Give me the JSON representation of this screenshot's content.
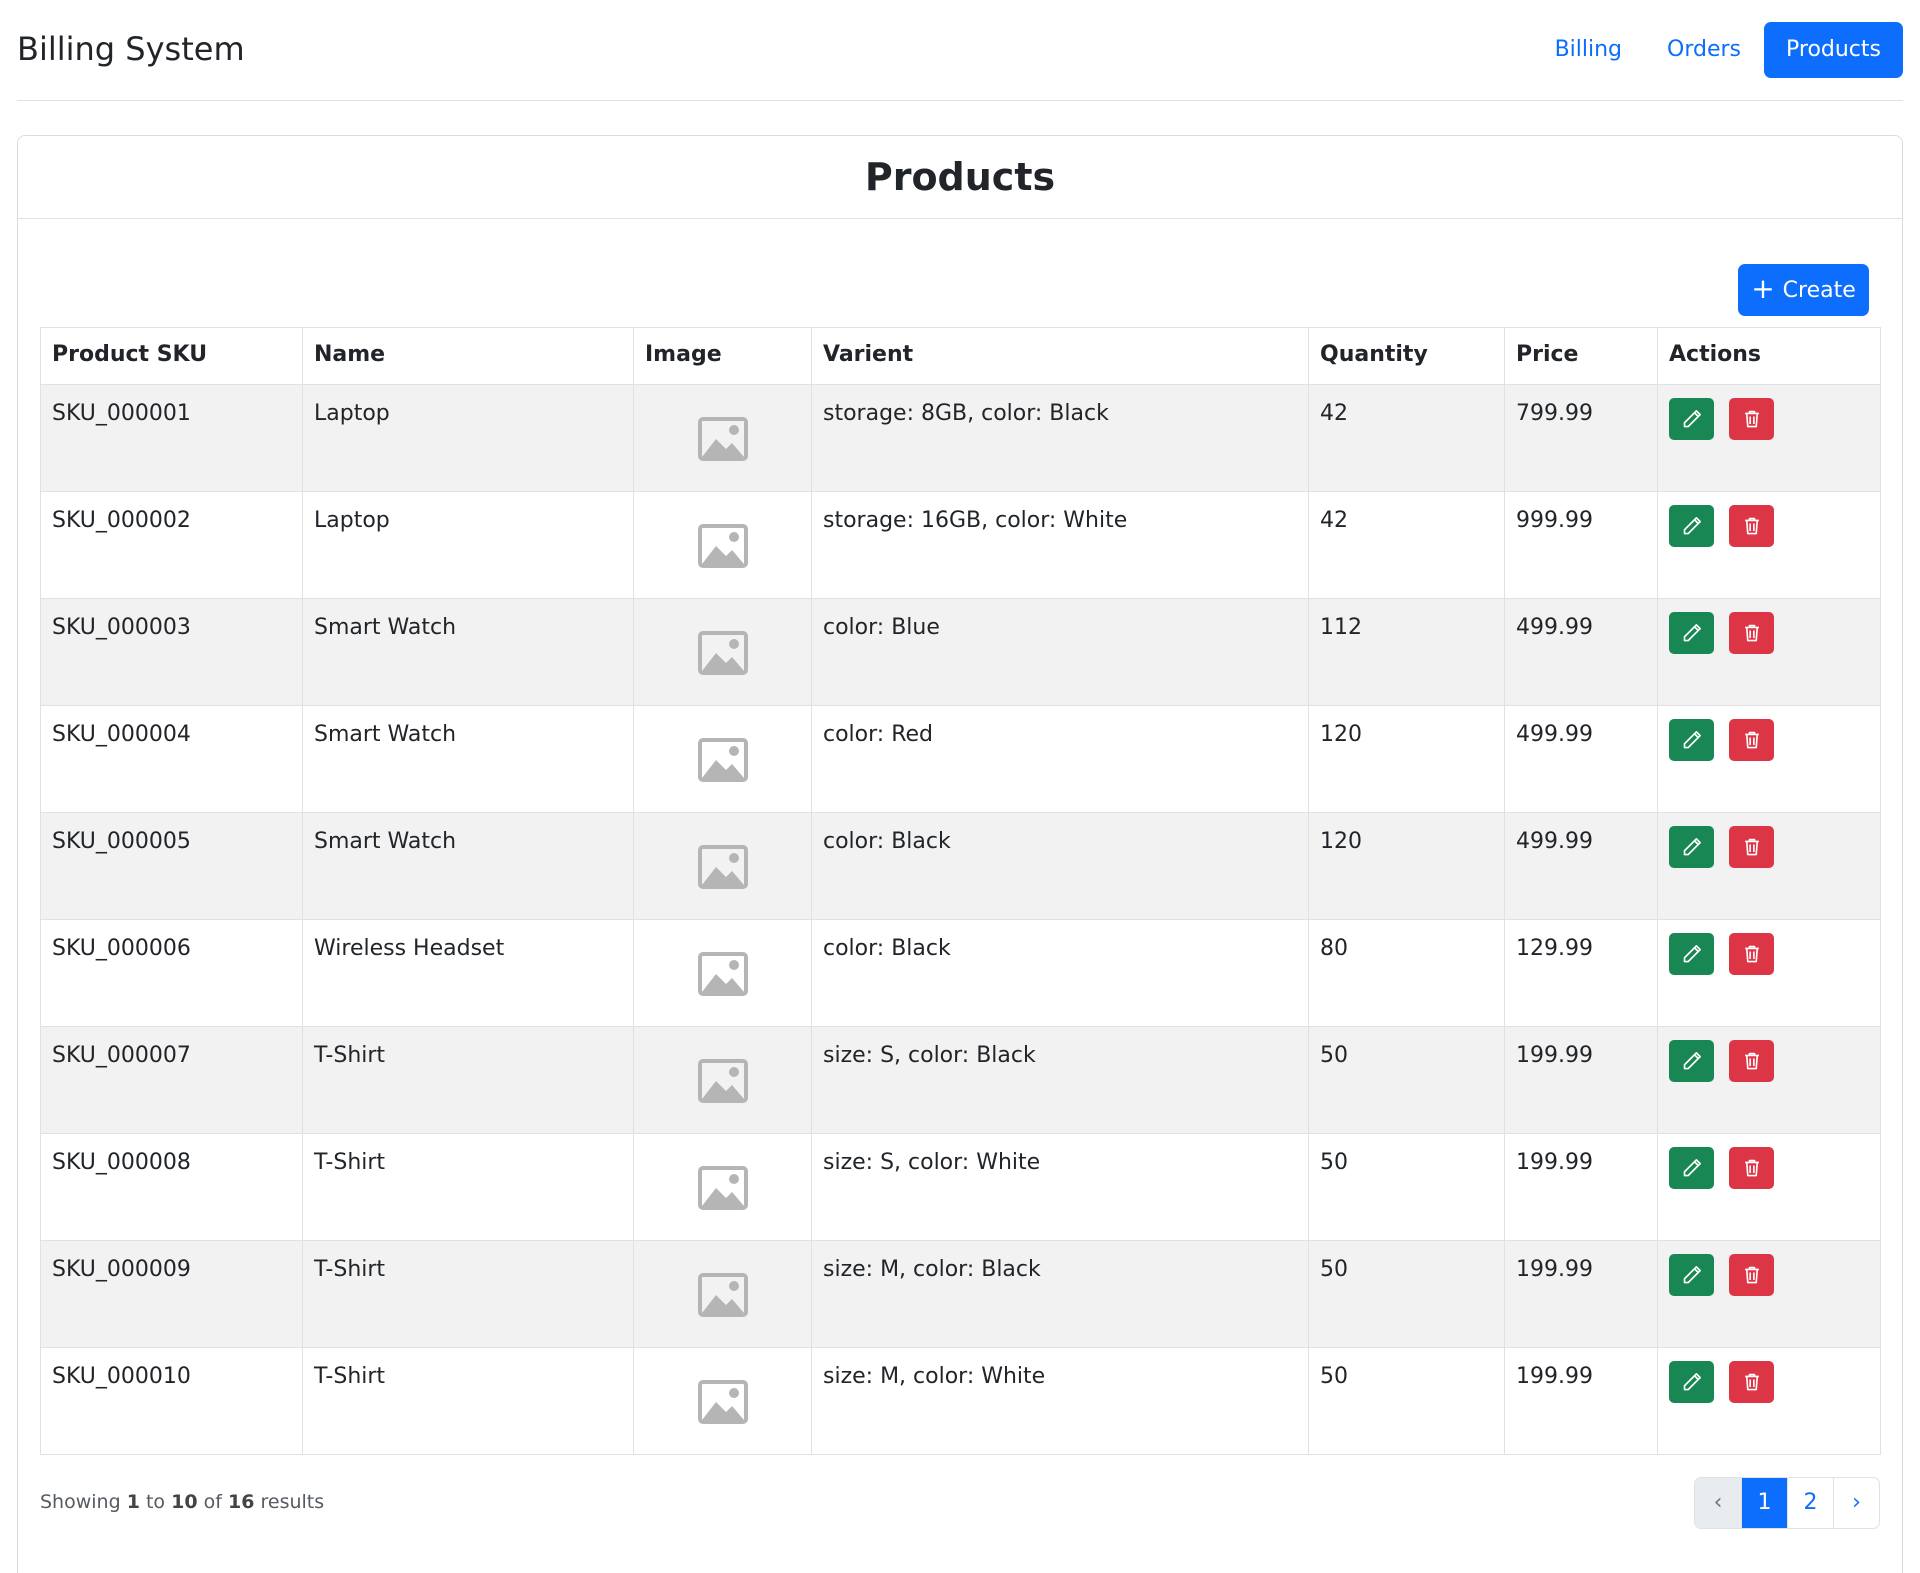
{
  "navbar": {
    "brand": "Billing System",
    "links": [
      {
        "label": "Billing",
        "active": false
      },
      {
        "label": "Orders",
        "active": false
      },
      {
        "label": "Products",
        "active": true
      }
    ]
  },
  "card": {
    "title": "Products",
    "create_label": "Create"
  },
  "table": {
    "headers": [
      "Product SKU",
      "Name",
      "Image",
      "Varient",
      "Quantity",
      "Price",
      "Actions"
    ],
    "rows": [
      {
        "sku": "SKU_000001",
        "name": "Laptop",
        "variant": "storage: 8GB, color: Black",
        "quantity": "42",
        "price": "799.99"
      },
      {
        "sku": "SKU_000002",
        "name": "Laptop",
        "variant": "storage: 16GB, color: White",
        "quantity": "42",
        "price": "999.99"
      },
      {
        "sku": "SKU_000003",
        "name": "Smart Watch",
        "variant": "color: Blue",
        "quantity": "112",
        "price": "499.99"
      },
      {
        "sku": "SKU_000004",
        "name": "Smart Watch",
        "variant": "color: Red",
        "quantity": "120",
        "price": "499.99"
      },
      {
        "sku": "SKU_000005",
        "name": "Smart Watch",
        "variant": "color: Black",
        "quantity": "120",
        "price": "499.99"
      },
      {
        "sku": "SKU_000006",
        "name": "Wireless Headset",
        "variant": "color: Black",
        "quantity": "80",
        "price": "129.99"
      },
      {
        "sku": "SKU_000007",
        "name": "T-Shirt",
        "variant": "size: S, color: Black",
        "quantity": "50",
        "price": "199.99"
      },
      {
        "sku": "SKU_000008",
        "name": "T-Shirt",
        "variant": "size: S, color: White",
        "quantity": "50",
        "price": "199.99"
      },
      {
        "sku": "SKU_000009",
        "name": "T-Shirt",
        "variant": "size: M, color: Black",
        "quantity": "50",
        "price": "199.99"
      },
      {
        "sku": "SKU_000010",
        "name": "T-Shirt",
        "variant": "size: M, color: White",
        "quantity": "50",
        "price": "199.99"
      }
    ]
  },
  "footer": {
    "showing": "Showing",
    "from": "1",
    "to_word": "to",
    "to": "10",
    "of_word": "of",
    "total": "16",
    "results": "results"
  },
  "pagination": {
    "prev": "‹",
    "pages": [
      "1",
      "2"
    ],
    "current": "1",
    "next": "›"
  },
  "colors": {
    "primary": "#0d6efd",
    "success": "#198754",
    "danger": "#dc3545"
  },
  "icons": {
    "image_placeholder": "image-placeholder-icon",
    "edit": "pencil-icon",
    "delete": "trash-icon",
    "create": "plus-icon"
  }
}
